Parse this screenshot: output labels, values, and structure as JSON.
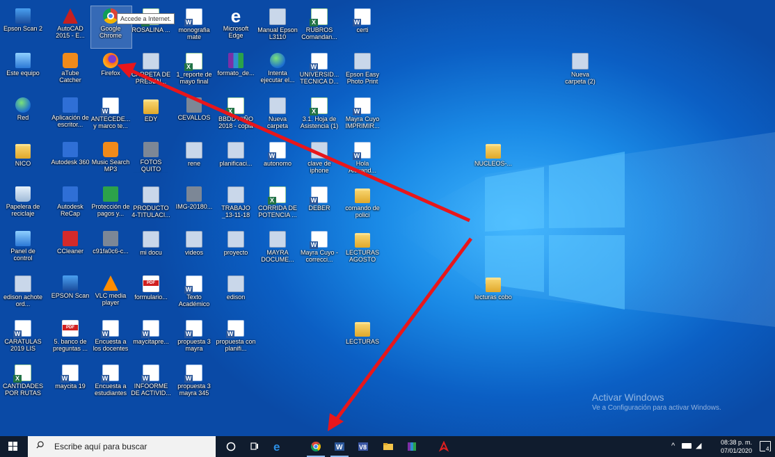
{
  "desktop_icons": [
    {
      "label": "Epson Scan 2",
      "type": "scan"
    },
    {
      "label": "AutoCAD 2015 - E...",
      "type": "autocad"
    },
    {
      "label": "Google Chrome",
      "type": "chrome"
    },
    {
      "label": "ROSALINA ...",
      "type": "excel"
    },
    {
      "label": "monografia mate",
      "type": "word"
    },
    {
      "label": "Microsoft Edge",
      "type": "edge"
    },
    {
      "label": "Manual Epson L3110",
      "type": "generic"
    },
    {
      "label": "RUBROS Comandan...",
      "type": "excel"
    },
    {
      "label": "certi",
      "type": "word"
    },
    {
      "label": "Este equipo",
      "type": "pc"
    },
    {
      "label": "aTube Catcher",
      "type": "orange"
    },
    {
      "label": "Firefox",
      "type": "firefox"
    },
    {
      "label": "CARPETA DE PRESEN...",
      "type": "generic"
    },
    {
      "label": "1_reporte de mayo final",
      "type": "excel"
    },
    {
      "label": "formato_de...",
      "type": "winrar"
    },
    {
      "label": "Intenta ejecutar el...",
      "type": "globe"
    },
    {
      "label": "UNIVERSID... TECNICA D...",
      "type": "word"
    },
    {
      "label": "Epson Easy Photo Print",
      "type": "generic"
    },
    {
      "label": "Red",
      "type": "globe"
    },
    {
      "label": "Aplicación de escritor...",
      "type": "blue"
    },
    {
      "label": "ANTECEDE... y marco te...",
      "type": "word"
    },
    {
      "label": "EDY",
      "type": "folder"
    },
    {
      "label": "CEVALLOS",
      "type": "gray"
    },
    {
      "label": "BBDD NIÑO 2018 - copia",
      "type": "excel"
    },
    {
      "label": "Nueva carpeta",
      "type": "generic"
    },
    {
      "label": "3.1. Hoja de Asistencia (1)",
      "type": "excel"
    },
    {
      "label": "Mayra Cuyo IMPRIMIR...",
      "type": "word"
    },
    {
      "label": "NICO",
      "type": "folder"
    },
    {
      "label": "Autodesk 360",
      "type": "blue"
    },
    {
      "label": "Music Search MP3",
      "type": "orange"
    },
    {
      "label": "FOTOS QUITO PROYECTO",
      "type": "gray"
    },
    {
      "label": "rene",
      "type": "generic"
    },
    {
      "label": "planificaci...",
      "type": "generic"
    },
    {
      "label": "autonomo",
      "type": "word"
    },
    {
      "label": "clave de iphone",
      "type": "generic"
    },
    {
      "label": "Hola Alexand...",
      "type": "word"
    },
    {
      "label": "Papelera de reciclaje",
      "type": "bin"
    },
    {
      "label": "Autodesk ReCap",
      "type": "blue"
    },
    {
      "label": "Protección de pagos y...",
      "type": "green"
    },
    {
      "label": "PRODUCTO 4-TITULACI...",
      "type": "generic"
    },
    {
      "label": "IMG-20180...",
      "type": "gray"
    },
    {
      "label": "TRABAJO _13-11-18",
      "type": "generic"
    },
    {
      "label": "CORRIDA DE POTENCIA ...",
      "type": "excel"
    },
    {
      "label": "DEBER",
      "type": "word"
    },
    {
      "label": "comando de polici",
      "type": "folder"
    },
    {
      "label": "Panel de control",
      "type": "pc"
    },
    {
      "label": "CCleaner",
      "type": "red"
    },
    {
      "label": "c91fa0c6-c...",
      "type": "gray"
    },
    {
      "label": "mi docu",
      "type": "generic"
    },
    {
      "label": "videos",
      "type": "generic"
    },
    {
      "label": "proyecto",
      "type": "generic"
    },
    {
      "label": "MAYRA DOCUME...",
      "type": "generic"
    },
    {
      "label": "Mayra Cuyo - correcci...",
      "type": "word"
    },
    {
      "label": "LECTURAS AGOSTO",
      "type": "folder"
    },
    {
      "label": "edison achote ord...",
      "type": "generic"
    },
    {
      "label": "EPSON Scan",
      "type": "scan"
    },
    {
      "label": "VLC media player",
      "type": "vlc"
    },
    {
      "label": "formulario...",
      "type": "pdf"
    },
    {
      "label": "Texto Académico",
      "type": "word"
    },
    {
      "label": "edison",
      "type": "generic"
    },
    {
      "label": "CARATULAS 2019 LIS",
      "type": "word"
    },
    {
      "label": "5. banco de preguntas ...",
      "type": "pdf"
    },
    {
      "label": "Encuesta a los docentes",
      "type": "word"
    },
    {
      "label": "maycitapre...",
      "type": "word"
    },
    {
      "label": "propuesta 3 mayra",
      "type": "word"
    },
    {
      "label": "propuesta con planifi...",
      "type": "word"
    },
    {
      "label": "LECTURAS",
      "type": "folder"
    },
    {
      "label": "CANTIDADES POR RUTAS",
      "type": "excel"
    },
    {
      "label": "maycita 19",
      "type": "word"
    },
    {
      "label": "Encuesta a estudiantes",
      "type": "word"
    },
    {
      "label": "INFOORME DE ACTIVID...",
      "type": "word"
    },
    {
      "label": "propuesta 3 mayra 345",
      "type": "word"
    },
    {
      "label": "Nueva carpeta (2)",
      "type": "generic"
    },
    {
      "label": "NUCLEOS-...",
      "type": "folder"
    },
    {
      "label": "lecturas cobo",
      "type": "folder"
    }
  ],
  "tooltip": "Accede a Internet.",
  "watermark": {
    "title": "Activar Windows",
    "subtitle": "Ve a Configuración para activar Windows."
  },
  "taskbar": {
    "search_placeholder": "Escribe aquí para buscar",
    "apps": [
      {
        "name": "cortana-icon",
        "active": false
      },
      {
        "name": "task-view-icon",
        "active": false
      },
      {
        "name": "edge-icon",
        "active": false
      },
      {
        "name": "chrome-icon",
        "active": true
      },
      {
        "name": "word-icon",
        "active": true
      },
      {
        "name": "visio-icon",
        "active": false
      },
      {
        "name": "file-explorer-icon",
        "active": false
      },
      {
        "name": "winrar-icon",
        "active": false
      },
      {
        "name": "acrobat-icon",
        "active": false
      }
    ],
    "clock_time": "08:38 p. m.",
    "clock_date": "07/01/2020",
    "notification_count": "4"
  },
  "colors": {
    "arrow": "#e8161b",
    "taskbar": "#101c2e",
    "desktop_accent": "#3fb6ff"
  }
}
